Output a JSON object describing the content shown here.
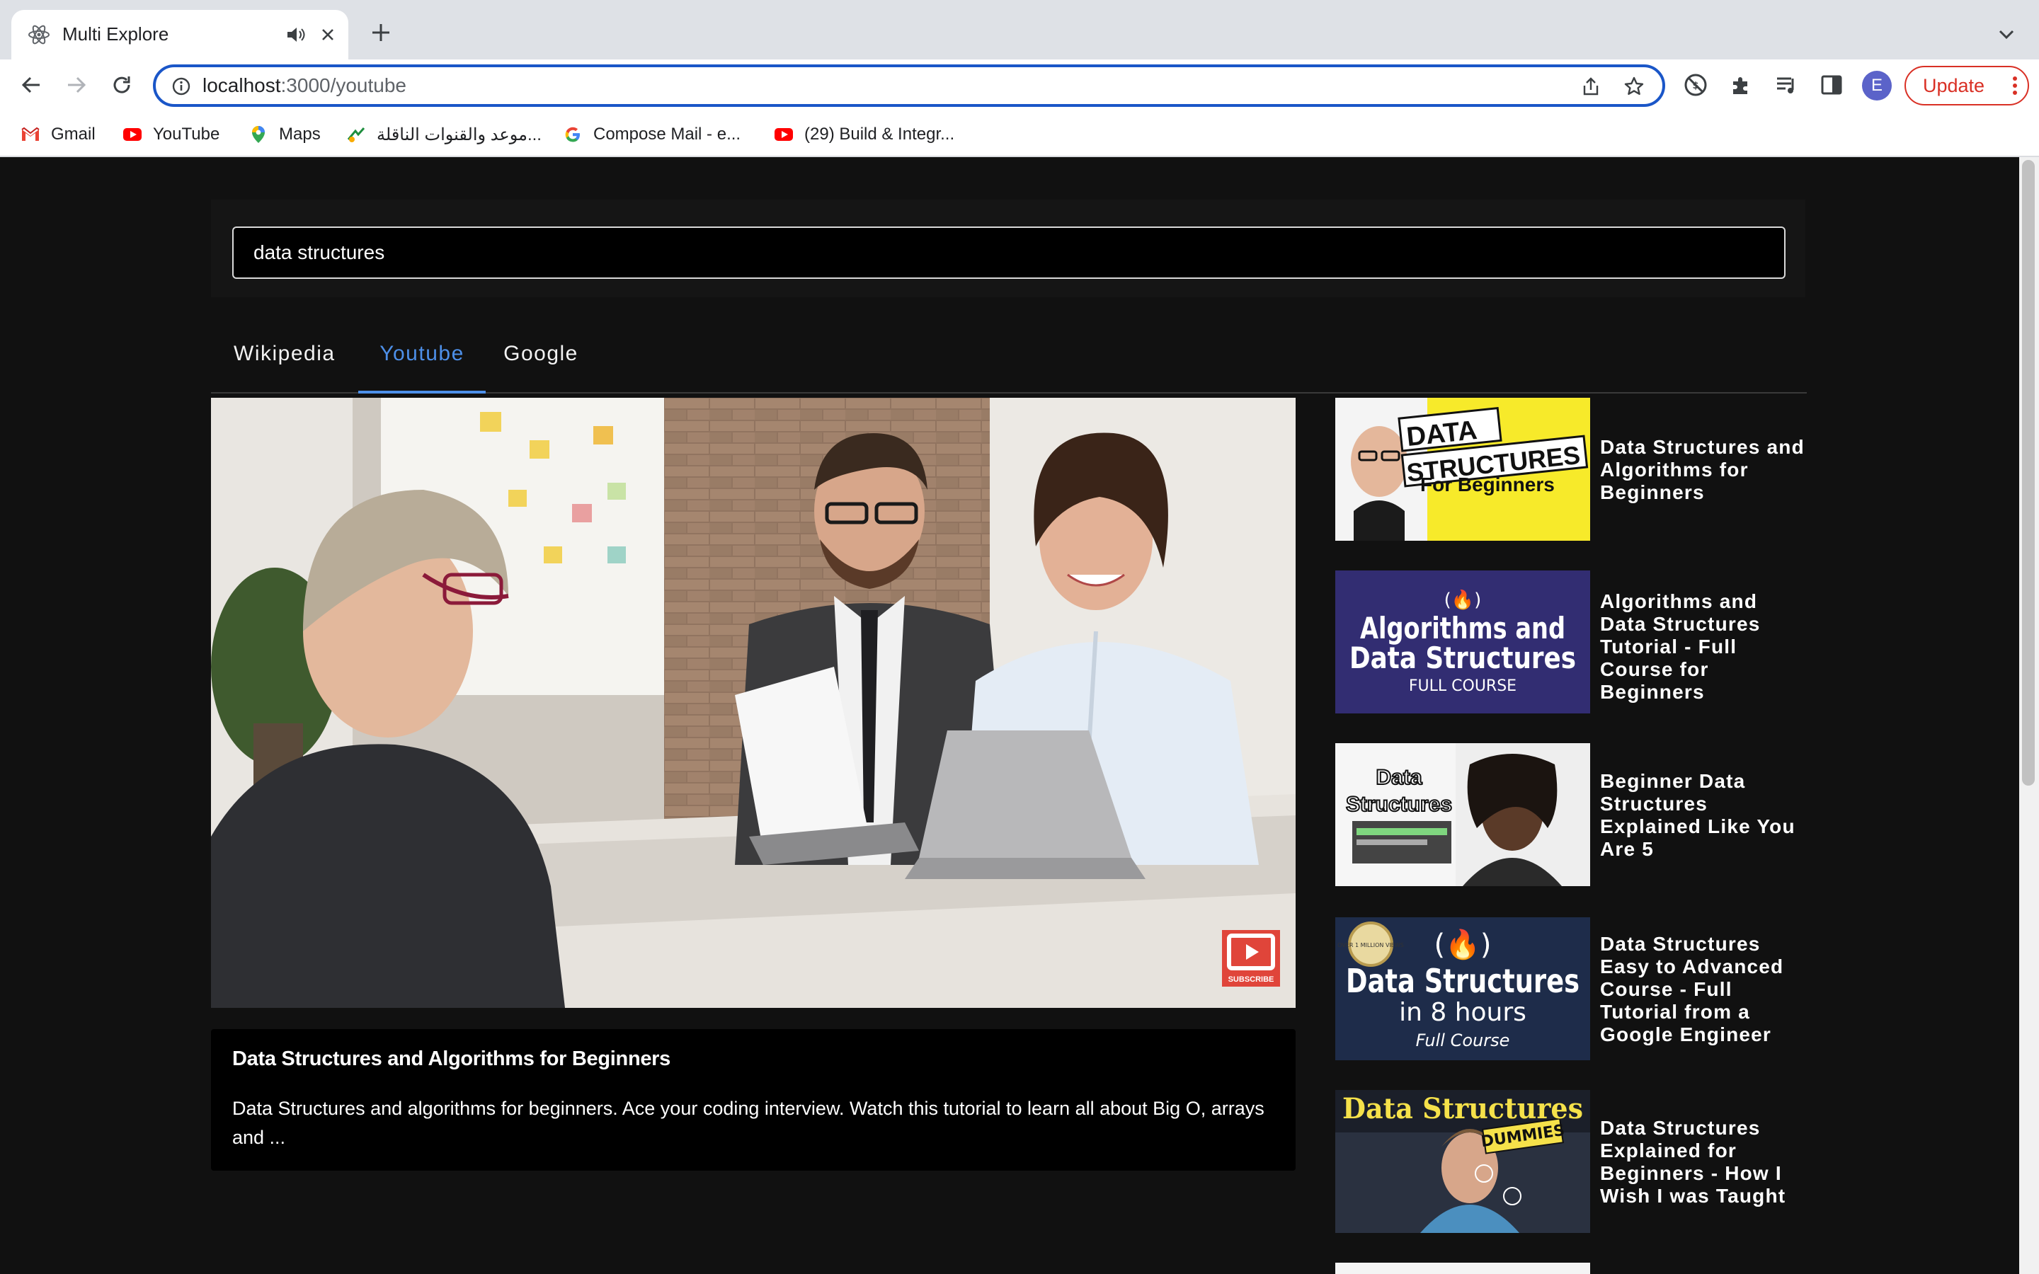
{
  "browser": {
    "tab_title": "Multi Explore",
    "url_host": "localhost",
    "url_path": ":3000/youtube",
    "profile_initial": "E",
    "update_label": "Update",
    "bookmarks": [
      {
        "label": "Gmail",
        "icon": "gmail-icon"
      },
      {
        "label": "YouTube",
        "icon": "youtube-icon"
      },
      {
        "label": "Maps",
        "icon": "maps-icon"
      },
      {
        "label": "موعد والقنوات الناقلة...",
        "icon": "sports-icon"
      },
      {
        "label": "Compose Mail - e...",
        "icon": "google-icon"
      },
      {
        "label": "(29) Build & Integr...",
        "icon": "youtube-icon"
      }
    ]
  },
  "search": {
    "value": "data structures"
  },
  "tabs": [
    {
      "label": "Wikipedia",
      "active": false
    },
    {
      "label": "Youtube",
      "active": true
    },
    {
      "label": "Google",
      "active": false
    }
  ],
  "main_video": {
    "title": "Data Structures and Algorithms for Beginners",
    "description": "Data Structures and algorithms for beginners. Ace your coding interview. Watch this tutorial to learn all about Big O, arrays and ...",
    "subscribe_label": "SUBSCRIBE"
  },
  "related": [
    {
      "title": "Data Structures and Algorithms for Beginners",
      "thumb_lines": [
        "DATA",
        "STRUCTURES",
        "For Beginners"
      ]
    },
    {
      "title": "Algorithms and Data Structures Tutorial - Full Course for Beginners",
      "thumb_lines": [
        "(🔥)",
        "Algorithms and",
        "Data Structures",
        "FULL COURSE"
      ]
    },
    {
      "title": "Beginner Data Structures Explained Like You Are 5",
      "thumb_lines": [
        "Data",
        "Structures"
      ]
    },
    {
      "title": "Data Structures Easy to Advanced Course - Full Tutorial from a Google Engineer",
      "thumb_lines": [
        "(🔥)",
        "Data Structures",
        "in 8 hours",
        "Full Course",
        "OVER 1 MILLION VIEWS"
      ]
    },
    {
      "title": "Data Structures Explained for Beginners - How I Wish I was Taught",
      "thumb_lines": [
        "Data Structures",
        "DUMMIES"
      ]
    }
  ],
  "colors": {
    "accent": "#4d8fe8",
    "page_bg": "#111111",
    "update_red": "#d93025"
  }
}
